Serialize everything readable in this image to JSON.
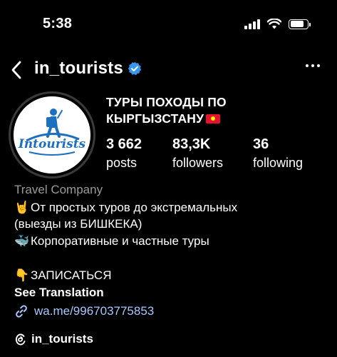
{
  "status_bar": {
    "time": "5:38",
    "signal_icon": "cellular-signal-icon",
    "wifi_icon": "wifi-icon",
    "battery_icon": "battery-icon",
    "battery_level": 0.8
  },
  "header": {
    "back_icon": "chevron-left-icon",
    "username": "in_tourists",
    "verified_icon": "verified-badge-icon",
    "more_icon": "more-horizontal-icon"
  },
  "profile": {
    "avatar_logo_text": "Intourists",
    "display_name_line1": "ТУРЫ ПОХОДЫ ПО",
    "display_name_line2": "КЫРГЫЗСТАНУ",
    "flag_icon": "kyrgyzstan-flag-icon",
    "stats": [
      {
        "value": "3 662",
        "label": "posts"
      },
      {
        "value": "83,3K",
        "label": "followers"
      },
      {
        "value": "36",
        "label": "following"
      }
    ]
  },
  "bio": {
    "category": "Travel Company",
    "lines": [
      {
        "emoji": "🤘",
        "emoji_icon": "rock-on-hand-icon",
        "text": "От простых туров до экстремальных"
      },
      {
        "emoji": "",
        "text": "(выезды из БИШКЕКА)"
      },
      {
        "emoji": "🐳",
        "emoji_icon": "whale-icon",
        "text": "Корпоративные и частные туры"
      },
      {
        "emoji": "👇",
        "emoji_icon": "pointing-down-icon",
        "text": "ЗАПИСАТЬСЯ"
      }
    ],
    "see_translation": "See Translation",
    "link_icon": "link-icon",
    "link": "wa.me/996703775853",
    "threads_icon": "threads-icon",
    "threads_handle": "in_tourists"
  },
  "colors": {
    "background": "#000000",
    "text": "#ffffff",
    "muted": "#9a9a9a",
    "link": "#a8c7ff",
    "verified": "#3797f0",
    "logo_blue": "#1d6fc0"
  }
}
